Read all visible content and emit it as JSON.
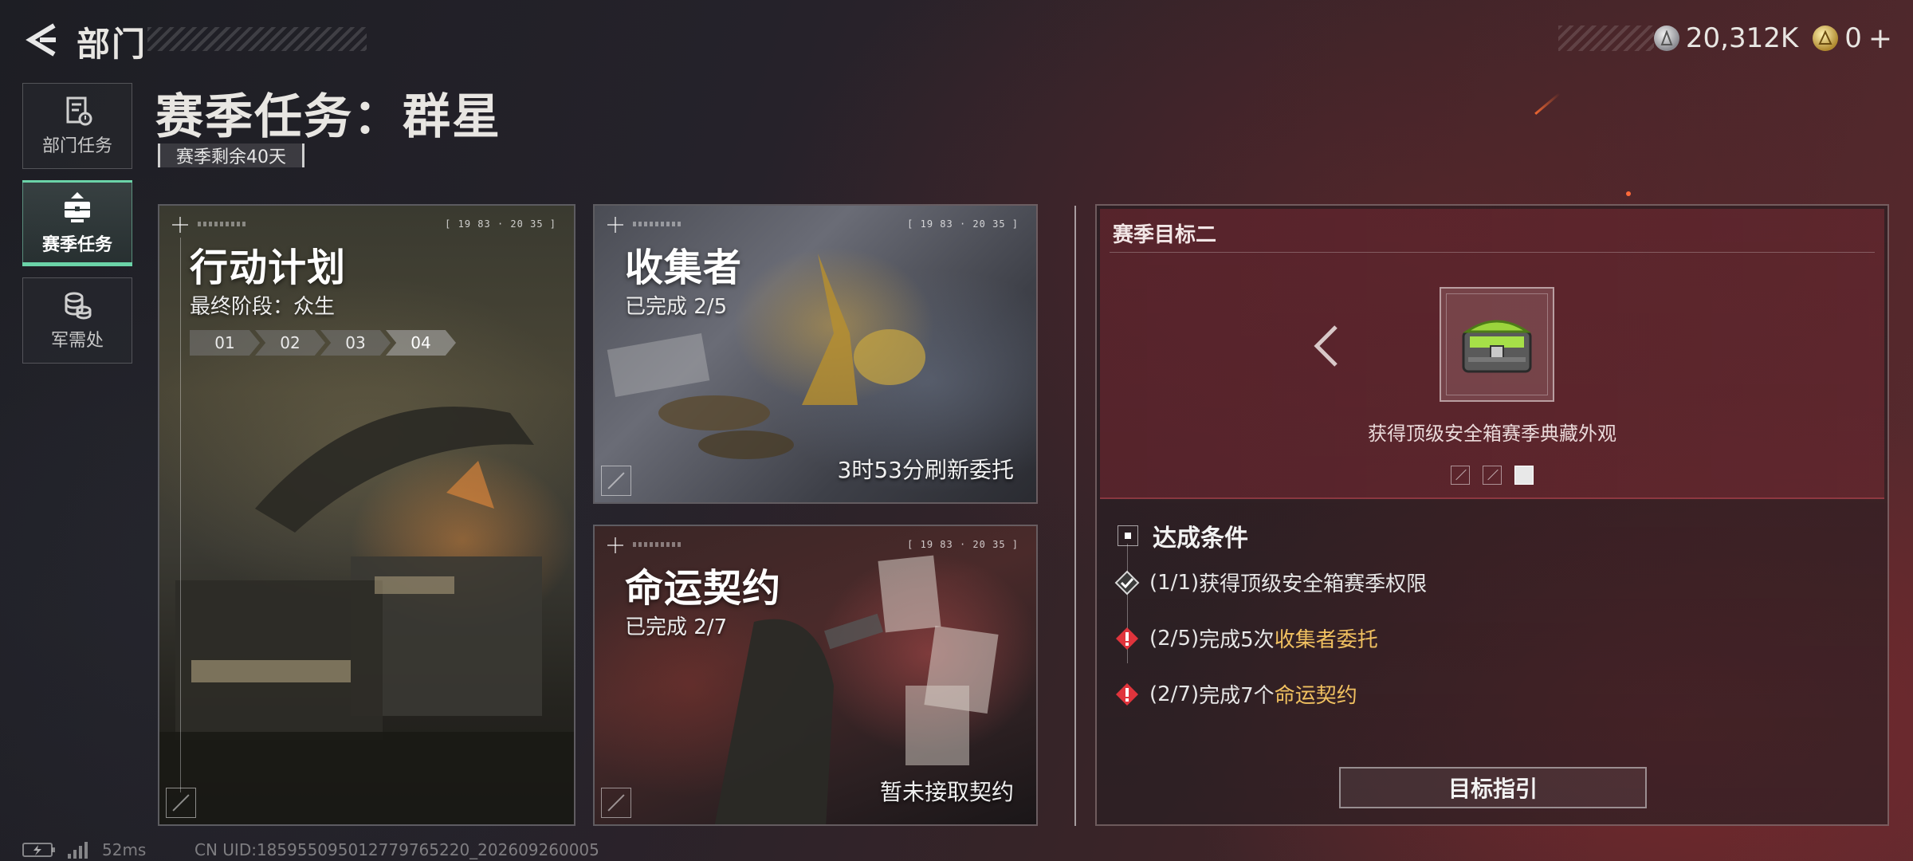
{
  "header": {
    "title": "部门",
    "currency": [
      {
        "icon": "silver-coin-icon",
        "value": "20,312K"
      },
      {
        "icon": "gold-coin-icon",
        "value": "0"
      }
    ],
    "plus_label": "+"
  },
  "sidebar": {
    "items": [
      {
        "label": "部门任务",
        "icon": "task-list-icon",
        "active": false
      },
      {
        "label": "赛季任务",
        "icon": "season-chest-icon",
        "active": true
      },
      {
        "label": "军需处",
        "icon": "coin-stack-icon",
        "active": false
      }
    ]
  },
  "page": {
    "title": "赛季任务：群星",
    "remaining": "赛季剩余40天"
  },
  "cards": {
    "plan": {
      "title": "行动计划",
      "subtitle": "最终阶段：众生",
      "time": "[ 19 83  ·  20 35 ]",
      "stages": [
        "01",
        "02",
        "03",
        "04"
      ],
      "current_stage": 4
    },
    "collector": {
      "title": "收集者",
      "subtitle": "已完成 2/5",
      "time": "[ 19 83  ·  20 35 ]",
      "footer": "3时53分刷新委托"
    },
    "fate": {
      "title": "命运契约",
      "subtitle": "已完成 2/7",
      "time": "[ 19 83  ·  20 35 ]",
      "footer": "暂未接取契约"
    }
  },
  "goal": {
    "title": "赛季目标二",
    "reward_desc": "获得顶级安全箱赛季典藏外观",
    "pages": 3,
    "active_page": 3,
    "conditions_title": "达成条件",
    "conditions": [
      {
        "status": "done",
        "progress": "(1/1)",
        "text": "获得顶级安全箱赛季权限",
        "highlight": ""
      },
      {
        "status": "warn",
        "progress": "(2/5)",
        "text": "完成5次",
        "highlight": "收集者委托"
      },
      {
        "status": "warn",
        "progress": "(2/7)",
        "text": "完成7个",
        "highlight": "命运契约"
      }
    ],
    "guide_button": "目标指引"
  },
  "status": {
    "ping": "52ms",
    "uid": "CN UID:185955095012779765220_202609260005"
  },
  "colors": {
    "accent_green": "#6bd3a8",
    "highlight": "#f0c060",
    "warn_red": "#e0343c"
  }
}
